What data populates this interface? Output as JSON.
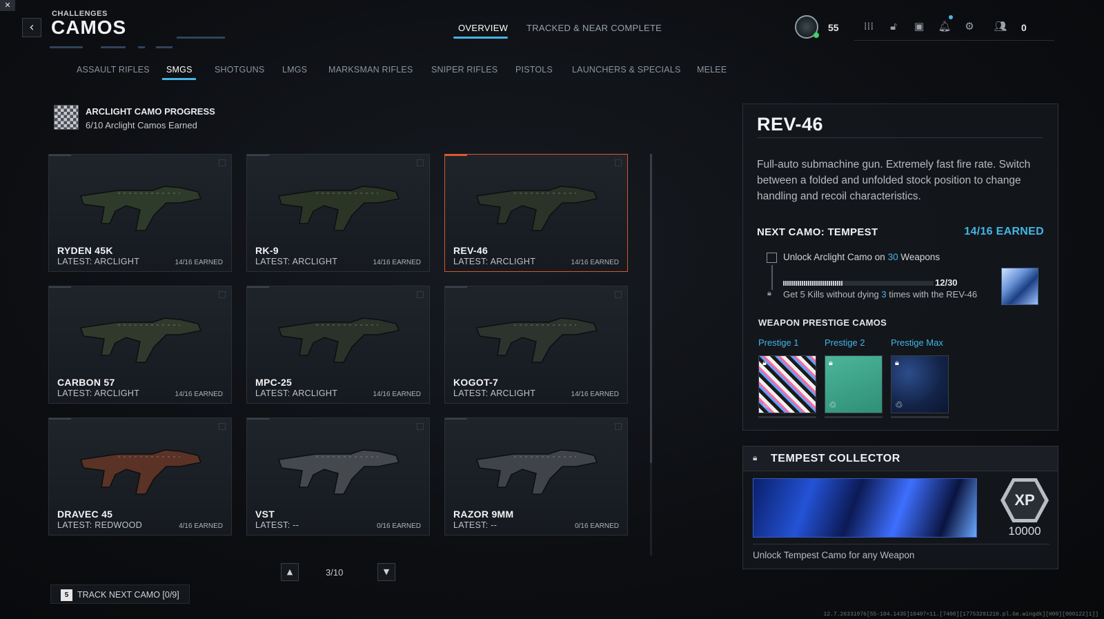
{
  "header": {
    "breadcrumb": "CHALLENGES",
    "title": "CAMOS",
    "back_icon": "chevron-left-icon",
    "mute_icon": "mute-icon"
  },
  "top_tabs": [
    {
      "label": "OVERVIEW",
      "active": true
    },
    {
      "label": "TRACKED & NEAR COMPLETE",
      "active": false
    }
  ],
  "top_right": {
    "level": "55",
    "friends_count": "0",
    "icons": [
      "apps-grid-icon",
      "unlock-icon",
      "camera-icon",
      "bell-icon",
      "gear-icon",
      "friends-icon"
    ]
  },
  "categories": [
    {
      "label": "ASSAULT RIFLES",
      "active": false
    },
    {
      "label": "SMGS",
      "active": true
    },
    {
      "label": "SHOTGUNS",
      "active": false
    },
    {
      "label": "LMGS",
      "active": false
    },
    {
      "label": "MARKSMAN RIFLES",
      "active": false
    },
    {
      "label": "SNIPER RIFLES",
      "active": false
    },
    {
      "label": "PISTOLS",
      "active": false
    },
    {
      "label": "LAUNCHERS & SPECIALS",
      "active": false
    },
    {
      "label": "MELEE",
      "active": false
    }
  ],
  "progress": {
    "title": "ARCLIGHT CAMO PROGRESS",
    "subtitle": "6/10 Arclight Camos Earned"
  },
  "weapons": [
    {
      "name": "RYDEN 45K",
      "latest": "LATEST: ARCLIGHT",
      "earned": "14/16 EARNED",
      "selected": false,
      "camo": "#2e3b2a"
    },
    {
      "name": "RK-9",
      "latest": "LATEST: ARCLIGHT",
      "earned": "14/16 EARNED",
      "selected": false,
      "camo": "#2a3526"
    },
    {
      "name": "REV-46",
      "latest": "LATEST: ARCLIGHT",
      "earned": "14/16 EARNED",
      "selected": true,
      "camo": "#2b3329"
    },
    {
      "name": "CARBON 57",
      "latest": "LATEST: ARCLIGHT",
      "earned": "14/16 EARNED",
      "selected": false,
      "camo": "#2f3a2c"
    },
    {
      "name": "MPC-25",
      "latest": "LATEST: ARCLIGHT",
      "earned": "14/16 EARNED",
      "selected": false,
      "camo": "#2a3229"
    },
    {
      "name": "KOGOT-7",
      "latest": "LATEST: ARCLIGHT",
      "earned": "14/16 EARNED",
      "selected": false,
      "camo": "#2d332d"
    },
    {
      "name": "DRAVEC 45",
      "latest": "LATEST: REDWOOD",
      "earned": "4/16 EARNED",
      "selected": false,
      "camo": "#5a3226"
    },
    {
      "name": "VST",
      "latest": "LATEST: --",
      "earned": "0/16 EARNED",
      "selected": false,
      "camo": "#45484d"
    },
    {
      "name": "RAZOR 9MM",
      "latest": "LATEST: --",
      "earned": "0/16 EARNED",
      "selected": false,
      "camo": "#404349"
    }
  ],
  "pagination": {
    "current": "3/10",
    "up_icon": "chevron-up-icon",
    "down_icon": "chevron-down-icon"
  },
  "track_button": {
    "key": "5",
    "label": "TRACK NEXT CAMO [0/9]"
  },
  "detail": {
    "name": "REV-46",
    "description": "Full-auto submachine gun. Extremely fast fire rate. Switch between a folded and unfolded stock position to change handling and recoil characteristics.",
    "next_camo": "NEXT CAMO: TEMPEST",
    "earned": "14/16 EARNED",
    "challenge_prefix": "Unlock Arclight Camo on ",
    "challenge_num": "30",
    "challenge_suffix": " Weapons",
    "challenge_count": "12/30",
    "challenge_progress": 0.4,
    "challenge2_prefix": "Get 5 Kills without dying ",
    "challenge2_num": "3",
    "challenge2_suffix": " times with the REV-46",
    "prestige_title": "WEAPON PRESTIGE CAMOS",
    "prestige": [
      {
        "label": "Prestige 1"
      },
      {
        "label": "Prestige 2"
      },
      {
        "label": "Prestige Max"
      }
    ]
  },
  "collector": {
    "title": "TEMPEST COLLECTOR",
    "xp_badge": "XP",
    "xp_value": "10000",
    "description": "Unlock Tempest Camo for any Weapon"
  },
  "footer_code": "12.7.26331976[55-104.1435]10407+11.[7400][17753291210.pl.Ge.wingdk][H00][000122]1]]"
}
